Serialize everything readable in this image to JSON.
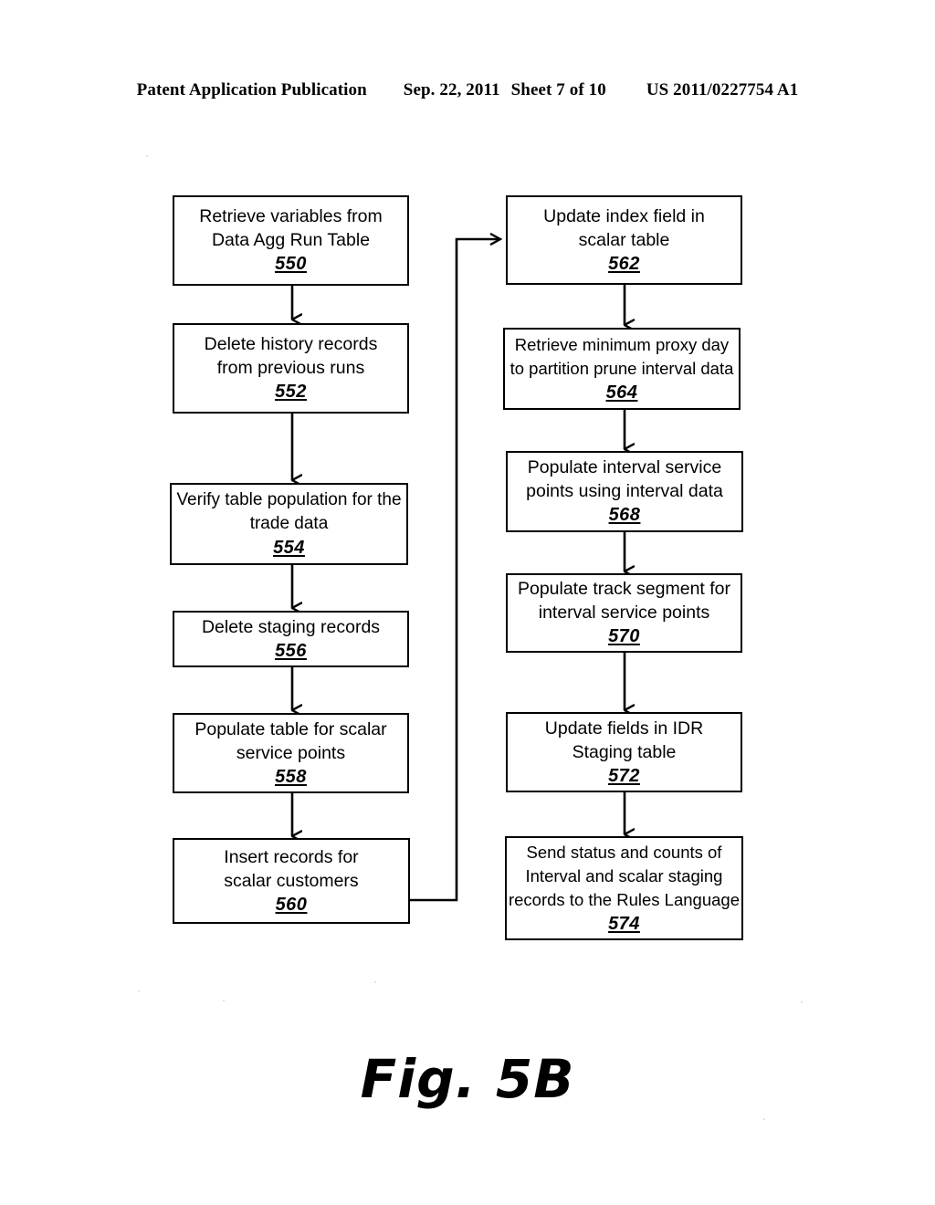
{
  "header": {
    "publication": "Patent Application Publication",
    "date": "Sep. 22, 2011",
    "sheet": "Sheet 7 of 10",
    "patent_number": "US 2011/0227754 A1"
  },
  "figure": {
    "caption": "Fig. 5B",
    "type": "flowchart",
    "line_color": "#000000",
    "background_color": "#ffffff"
  },
  "flowchart": {
    "left_column": [
      {
        "id": "node-550",
        "text": "Retrieve variables from\nData Agg Run Table",
        "ref": "550"
      },
      {
        "id": "node-552",
        "text": "Delete history records\nfrom previous runs",
        "ref": "552"
      },
      {
        "id": "node-554",
        "text": "Verify table population for the\ntrade data",
        "ref": "554"
      },
      {
        "id": "node-556",
        "text": "Delete staging records",
        "ref": "556"
      },
      {
        "id": "node-558",
        "text": "Populate table for scalar\nservice points",
        "ref": "558"
      },
      {
        "id": "node-560",
        "text": "Insert records for\nscalar customers",
        "ref": "560"
      }
    ],
    "right_column": [
      {
        "id": "node-562",
        "text": "Update index field in\nscalar table",
        "ref": "562"
      },
      {
        "id": "node-564",
        "text": "Retrieve minimum proxy day\nto partition prune interval data",
        "ref": "564"
      },
      {
        "id": "node-568",
        "text": "Populate interval service\npoints using interval data",
        "ref": "568"
      },
      {
        "id": "node-570",
        "text": "Populate track segment for\ninterval service points",
        "ref": "570"
      },
      {
        "id": "node-572",
        "text": "Update fields in IDR\nStaging table",
        "ref": "572"
      },
      {
        "id": "node-574",
        "text": "Send status and counts of\nInterval and scalar staging\nrecords to the Rules Language",
        "ref": "574"
      }
    ],
    "connectors": [
      {
        "from": "550",
        "to": "552",
        "kind": "vertical-arrow"
      },
      {
        "from": "552",
        "to": "554",
        "kind": "vertical-arrow"
      },
      {
        "from": "554",
        "to": "556",
        "kind": "vertical-arrow"
      },
      {
        "from": "556",
        "to": "558",
        "kind": "vertical-arrow"
      },
      {
        "from": "558",
        "to": "560",
        "kind": "vertical-arrow"
      },
      {
        "from": "560",
        "to": "562",
        "kind": "elbow-arrow"
      },
      {
        "from": "562",
        "to": "564",
        "kind": "vertical-arrow"
      },
      {
        "from": "564",
        "to": "568",
        "kind": "vertical-arrow"
      },
      {
        "from": "568",
        "to": "570",
        "kind": "vertical-arrow"
      },
      {
        "from": "570",
        "to": "572",
        "kind": "vertical-arrow"
      },
      {
        "from": "572",
        "to": "574",
        "kind": "vertical-arrow"
      }
    ]
  }
}
